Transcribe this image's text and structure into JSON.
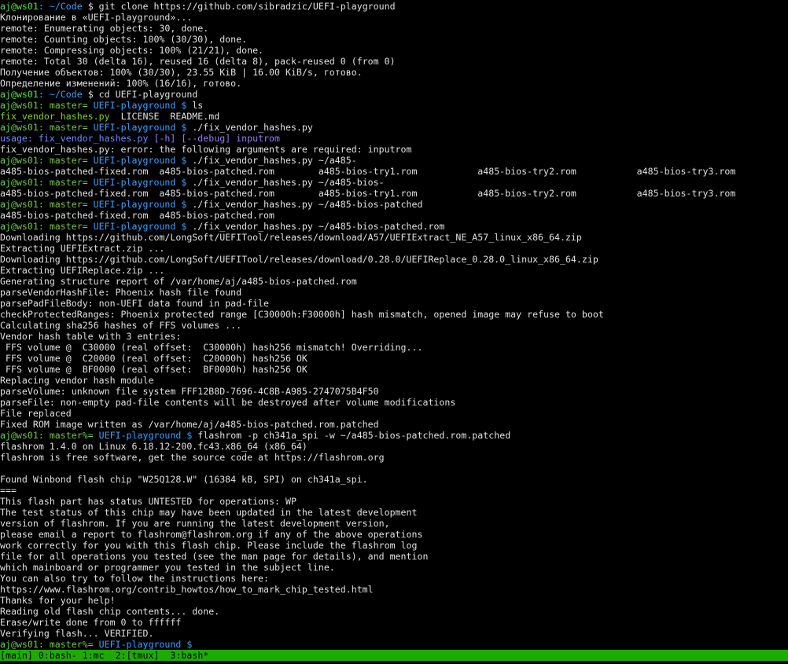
{
  "colors": {
    "default": "#e0e0e0",
    "user": "#55e04c",
    "host": "#55e04c",
    "path": "#3aa0ff",
    "branch": "#6fc44a",
    "exe": "#7ed31b",
    "usage": "#6a8cff",
    "opt": "#9a78ff",
    "status_bg": "#1faa00",
    "status_fg": "#000000"
  },
  "terminal": {
    "lines": [
      [
        {
          "t": "aj",
          "c": "user"
        },
        {
          "t": "@ws01",
          "c": "host"
        },
        {
          "t": ": ~/Code",
          "c": "path"
        },
        {
          "t": " $ git clone https://github.com/sibradzic/UEFI-playground",
          "c": "default"
        }
      ],
      [
        {
          "t": "Клонирование в «UEFI-playground»...",
          "c": "default"
        }
      ],
      [
        {
          "t": "remote: Enumerating objects: 30, done.",
          "c": "default"
        }
      ],
      [
        {
          "t": "remote: Counting objects: 100% (30/30), done.",
          "c": "default"
        }
      ],
      [
        {
          "t": "remote: Compressing objects: 100% (21/21), done.",
          "c": "default"
        }
      ],
      [
        {
          "t": "remote: Total 30 (delta 16), reused 16 (delta 8), pack-reused 0 (from 0)",
          "c": "default"
        }
      ],
      [
        {
          "t": "Получение объектов: 100% (30/30), 23.55 KiB | 16.00 KiB/s, готово.",
          "c": "default"
        }
      ],
      [
        {
          "t": "Определение изменений: 100% (16/16), готово.",
          "c": "default"
        }
      ],
      [
        {
          "t": "aj",
          "c": "user"
        },
        {
          "t": "@ws01",
          "c": "host"
        },
        {
          "t": ": ~/Code",
          "c": "path"
        },
        {
          "t": " $ cd UEFI-playground",
          "c": "default"
        }
      ],
      [
        {
          "t": "aj",
          "c": "user"
        },
        {
          "t": "@ws01: master= ",
          "c": "branch"
        },
        {
          "t": "UEFI-playground $",
          "c": "path"
        },
        {
          "t": " ls",
          "c": "default"
        }
      ],
      [
        {
          "t": "fix_vendor_hashes.py",
          "c": "exe"
        },
        {
          "t": "  LICENSE  README.md",
          "c": "default"
        }
      ],
      [
        {
          "t": "aj",
          "c": "user"
        },
        {
          "t": "@ws01: master= ",
          "c": "branch"
        },
        {
          "t": "UEFI-playground $",
          "c": "path"
        },
        {
          "t": " ./fix_vendor_hashes.py",
          "c": "default"
        }
      ],
      [
        {
          "t": "usage: fix_vendor_hashes.py ",
          "c": "usage"
        },
        {
          "t": "[-h] ",
          "c": "opt"
        },
        {
          "t": "[--debug] ",
          "c": "opt"
        },
        {
          "t": "inputrom",
          "c": "opt"
        }
      ],
      [
        {
          "t": "fix_vendor_hashes.py: error: the following arguments are required: inputrom",
          "c": "default"
        }
      ],
      [
        {
          "t": "aj",
          "c": "user"
        },
        {
          "t": "@ws01: master= ",
          "c": "branch"
        },
        {
          "t": "UEFI-playground $",
          "c": "path"
        },
        {
          "t": " ./fix_vendor_hashes.py ~/a485-",
          "c": "default"
        }
      ],
      [
        {
          "t": "a485-bios-patched-fixed.rom  a485-bios-patched.rom        a485-bios-try1.rom           a485-bios-try2.rom           a485-bios-try3.rom",
          "c": "default"
        }
      ],
      [
        {
          "t": "aj",
          "c": "user"
        },
        {
          "t": "@ws01: master= ",
          "c": "branch"
        },
        {
          "t": "UEFI-playground $",
          "c": "path"
        },
        {
          "t": " ./fix_vendor_hashes.py ~/a485-bios-",
          "c": "default"
        }
      ],
      [
        {
          "t": "a485-bios-patched-fixed.rom  a485-bios-patched.rom        a485-bios-try1.rom           a485-bios-try2.rom           a485-bios-try3.rom",
          "c": "default"
        }
      ],
      [
        {
          "t": "aj",
          "c": "user"
        },
        {
          "t": "@ws01: master= ",
          "c": "branch"
        },
        {
          "t": "UEFI-playground $",
          "c": "path"
        },
        {
          "t": " ./fix_vendor_hashes.py ~/a485-bios-patched",
          "c": "default"
        }
      ],
      [
        {
          "t": "a485-bios-patched-fixed.rom  a485-bios-patched.rom",
          "c": "default"
        }
      ],
      [
        {
          "t": "aj",
          "c": "user"
        },
        {
          "t": "@ws01: master= ",
          "c": "branch"
        },
        {
          "t": "UEFI-playground $",
          "c": "path"
        },
        {
          "t": " ./fix_vendor_hashes.py ~/a485-bios-patched.rom",
          "c": "default"
        }
      ],
      [
        {
          "t": "Downloading https://github.com/LongSoft/UEFITool/releases/download/A57/UEFIExtract_NE_A57_linux_x86_64.zip",
          "c": "default"
        }
      ],
      [
        {
          "t": "Extracting UEFIExtract.zip ...",
          "c": "default"
        }
      ],
      [
        {
          "t": "Downloading https://github.com/LongSoft/UEFITool/releases/download/0.28.0/UEFIReplace_0.28.0_linux_x86_64.zip",
          "c": "default"
        }
      ],
      [
        {
          "t": "Extracting UEFIReplace.zip ...",
          "c": "default"
        }
      ],
      [
        {
          "t": "Generating structure report of /var/home/aj/a485-bios-patched.rom",
          "c": "default"
        }
      ],
      [
        {
          "t": "parseVendorHashFile: Phoenix hash file found",
          "c": "default"
        }
      ],
      [
        {
          "t": "parsePadFileBody: non-UEFI data found in pad-file",
          "c": "default"
        }
      ],
      [
        {
          "t": "checkProtectedRanges: Phoenix protected range [C30000h:F30000h] hash mismatch, opened image may refuse to boot",
          "c": "default"
        }
      ],
      [
        {
          "t": "Calculating sha256 hashes of FFS volumes ...",
          "c": "default"
        }
      ],
      [
        {
          "t": "Vendor hash table with 3 entries:",
          "c": "default"
        }
      ],
      [
        {
          "t": " FFS volume @  C30000 (real offset:  C30000h) hash256 mismatch! Overriding...",
          "c": "default"
        }
      ],
      [
        {
          "t": " FFS volume @  C20000 (real offset:  C20000h) hash256 OK",
          "c": "default"
        }
      ],
      [
        {
          "t": " FFS volume @  BF0000 (real offset:  BF0000h) hash256 OK",
          "c": "default"
        }
      ],
      [
        {
          "t": "Replacing vendor hash module",
          "c": "default"
        }
      ],
      [
        {
          "t": "parseVolume: unknown file system FFF12B8D-7696-4C8B-A985-2747075B4F50",
          "c": "default"
        }
      ],
      [
        {
          "t": "parseFile: non-empty pad-file contents will be destroyed after volume modifications",
          "c": "default"
        }
      ],
      [
        {
          "t": "File replaced",
          "c": "default"
        }
      ],
      [
        {
          "t": "Fixed ROM image written as /var/home/aj/a485-bios-patched.rom.patched",
          "c": "default"
        }
      ],
      [
        {
          "t": "aj",
          "c": "user"
        },
        {
          "t": "@ws01: master%= ",
          "c": "branch"
        },
        {
          "t": "UEFI-playground $",
          "c": "path"
        },
        {
          "t": " flashrom -p ch341a_spi -w ~/a485-bios-patched.rom.patched",
          "c": "default"
        }
      ],
      [
        {
          "t": "flashrom 1.4.0 on Linux 6.18.12-200.fc43.x86_64 (x86_64)",
          "c": "default"
        }
      ],
      [
        {
          "t": "flashrom is free software, get the source code at https://flashrom.org",
          "c": "default"
        }
      ],
      [
        {
          "t": "",
          "c": "default"
        }
      ],
      [
        {
          "t": "Found Winbond flash chip \"W25Q128.W\" (16384 kB, SPI) on ch341a_spi.",
          "c": "default"
        }
      ],
      [
        {
          "t": "===",
          "c": "default"
        }
      ],
      [
        {
          "t": "This flash part has status UNTESTED for operations: WP",
          "c": "default"
        }
      ],
      [
        {
          "t": "The test status of this chip may have been updated in the latest development",
          "c": "default"
        }
      ],
      [
        {
          "t": "version of flashrom. If you are running the latest development version,",
          "c": "default"
        }
      ],
      [
        {
          "t": "please email a report to flashrom@flashrom.org if any of the above operations",
          "c": "default"
        }
      ],
      [
        {
          "t": "work correctly for you with this flash chip. Please include the flashrom log",
          "c": "default"
        }
      ],
      [
        {
          "t": "file for all operations you tested (see the man page for details), and mention",
          "c": "default"
        }
      ],
      [
        {
          "t": "which mainboard or programmer you tested in the subject line.",
          "c": "default"
        }
      ],
      [
        {
          "t": "You can also try to follow the instructions here:",
          "c": "default"
        }
      ],
      [
        {
          "t": "https://www.flashrom.org/contrib_howtos/how_to_mark_chip_tested.html",
          "c": "default"
        }
      ],
      [
        {
          "t": "Thanks for your help!",
          "c": "default"
        }
      ],
      [
        {
          "t": "Reading old flash chip contents... done.",
          "c": "default"
        }
      ],
      [
        {
          "t": "Erase/write done from 0 to ffffff",
          "c": "default"
        }
      ],
      [
        {
          "t": "Verifying flash... VERIFIED.",
          "c": "default"
        }
      ],
      [
        {
          "t": "aj",
          "c": "user"
        },
        {
          "t": "@ws01: master%= ",
          "c": "branch"
        },
        {
          "t": "UEFI-playground $",
          "c": "path"
        }
      ]
    ]
  },
  "tmux_status": {
    "segments": [
      {
        "t": "[main] ",
        "name": "tmux-session-name"
      },
      {
        "t": "0:bash- ",
        "name": "tmux-window-0"
      },
      {
        "t": "1:mc  ",
        "name": "tmux-window-1"
      },
      {
        "t": "2:[tmux]  ",
        "name": "tmux-window-2"
      },
      {
        "t": "3:bash*",
        "name": "tmux-window-3"
      }
    ]
  }
}
